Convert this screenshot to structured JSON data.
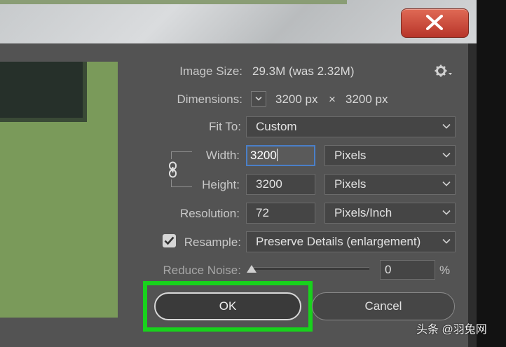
{
  "dialog": {
    "close_icon": "close-x-icon",
    "settings_icon": "gear-icon"
  },
  "image_size": {
    "label": "Image Size:",
    "value": "29.3M (was 2.32M)"
  },
  "dimensions": {
    "label": "Dimensions:",
    "width": "3200 px",
    "times": "×",
    "height": "3200 px"
  },
  "fit_to": {
    "label": "Fit To:",
    "value": "Custom"
  },
  "width": {
    "label": "Width:",
    "value": "3200",
    "unit": "Pixels"
  },
  "height": {
    "label": "Height:",
    "value": "3200",
    "unit": "Pixels"
  },
  "resolution": {
    "label": "Resolution:",
    "value": "72",
    "unit": "Pixels/Inch"
  },
  "resample": {
    "label": "Resample:",
    "checked": true,
    "value": "Preserve Details (enlargement)"
  },
  "reduce_noise": {
    "label": "Reduce Noise:",
    "value": "0",
    "unit": "%",
    "level": 0
  },
  "buttons": {
    "ok": "OK",
    "cancel": "Cancel"
  },
  "watermark": "头条 @羽兔网",
  "colors": {
    "highlight": "#18d21c",
    "close": "#c9473a",
    "focus": "#4a7fc8"
  }
}
